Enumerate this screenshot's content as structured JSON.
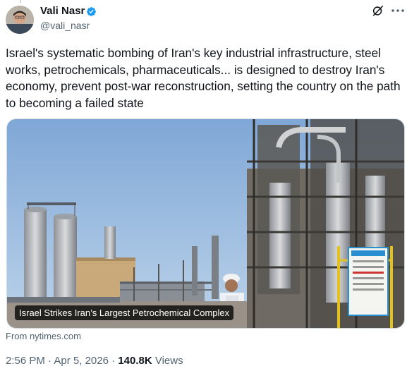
{
  "author": {
    "name": "Vali Nasr",
    "handle": "@vali_nasr",
    "verified": true,
    "avatar_icon": "profile-photo"
  },
  "header_actions": {
    "grok_icon": "grok-icon",
    "more_icon": "more-dots-icon"
  },
  "tweet": {
    "text": "Israel's systematic bombing of Iran's key industrial infrastructure, steel works, petrochemicals, pharmaceuticals... is designed to destroy Iran's economy, prevent post-war reconstruction, setting the country on the path to becoming a failed state"
  },
  "card": {
    "caption": "Israel Strikes Iran’s Largest Petrochemical Complex",
    "source": "From nytimes.com"
  },
  "meta": {
    "time": "2:56 PM",
    "sep1": " · ",
    "date": "Apr 5, 2026",
    "sep2": " · ",
    "views_count": "140.8K",
    "views_label": " Views"
  },
  "colors": {
    "text": "#0f1419",
    "secondary": "#536471",
    "verified": "#1d9bf0",
    "border": "#cfd9de"
  }
}
